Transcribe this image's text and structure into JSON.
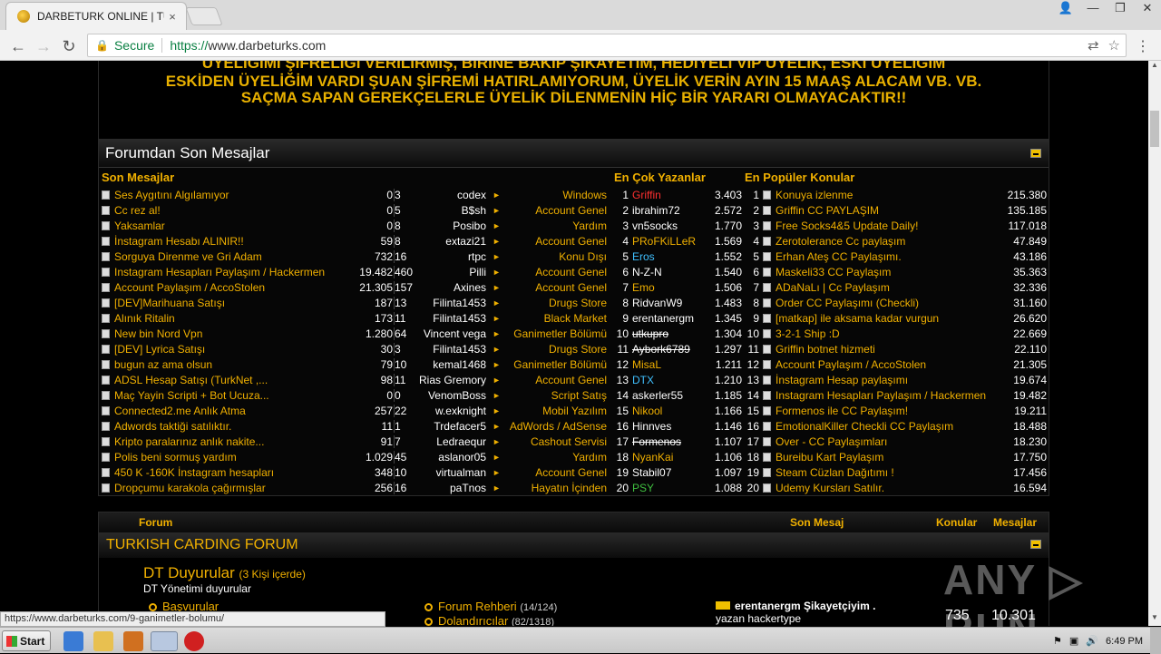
{
  "browser": {
    "tab_title": "DARBETURK ONLINE | TURK",
    "tab_close": "×",
    "secure_label": "Secure",
    "url_scheme": "https://",
    "url_host": "www.darbeturks.com",
    "back": "←",
    "forward": "→",
    "reload": "↻",
    "min": "—",
    "max": "❐",
    "close": "✕",
    "user": "👤",
    "translate": "⇄",
    "star": "☆",
    "menu": "⋮"
  },
  "notice": {
    "line1": "ÜYELİĞİMİ ŞİFRELİĞİ VERİLİRMİŞ, BİRİNE BAKIP ŞİKAYETİM, HEDİYELİ VIP ÜYELİK, ESKİ ÜYELİĞİM",
    "line2": "ESKİDEN ÜYELİĞİM VARDI ŞUAN ŞİFREMİ HATIRLAMIYORUM, ÜYELİK VERİN AYIN 15 MAAŞ ALACAM VB. VB.",
    "line3": "SAÇMA SAPAN GEREKÇELERLE ÜYELİK DİLENMENİN HİÇ BİR YARARI OLMAYACAKTIR!!"
  },
  "recent": {
    "title": "Forumdan Son Mesajlar",
    "col_recent": "Son Mesajlar",
    "col_top": "En Çok Yazanlar",
    "col_popular": "En Popüler Konular",
    "rows": [
      {
        "title": "Ses Aygıtını Algılamıyor",
        "views": "0",
        "replies": "3",
        "user": "codex",
        "cat": "Windows",
        "rank": "1",
        "top": "Griffin",
        "top_color": "#ff3030",
        "top_count": "3.403",
        "prank": "1",
        "pop": "Konuya izlenme",
        "pcount": "215.380"
      },
      {
        "title": "Cc rez al!",
        "views": "0",
        "replies": "5",
        "user": "B$sh",
        "cat": "Account Genel",
        "rank": "2",
        "top": "ibrahim72",
        "top_color": "#ffffff",
        "top_count": "2.572",
        "prank": "2",
        "pop": "Griffin CC PAYLAŞIM",
        "pcount": "135.185"
      },
      {
        "title": "Yaksamlar",
        "views": "0",
        "replies": "8",
        "user": "Posibo",
        "cat": "Yardım",
        "rank": "3",
        "top": "vn5socks",
        "top_color": "#ffffff",
        "top_count": "1.770",
        "prank": "3",
        "pop": "Free Socks4&5 Update Daily!",
        "pcount": "117.018"
      },
      {
        "title": "İnstagram Hesabı ALINIR!!",
        "views": "59",
        "replies": "8",
        "user": "extazi21",
        "cat": "Account Genel",
        "rank": "4",
        "top": "PRoFKiLLeR",
        "top_color": "#f0b000",
        "top_count": "1.569",
        "prank": "4",
        "pop": "Zerotolerance Cc paylaşım",
        "pcount": "47.849"
      },
      {
        "title": "Sorguya Direnme ve Gri Adam",
        "views": "732",
        "replies": "16",
        "user": "rtpc",
        "cat": "Konu Dışı",
        "rank": "5",
        "top": "Eros",
        "top_color": "#40c0ff",
        "top_count": "1.552",
        "prank": "5",
        "pop": "Erhan Ateş CC Paylaşımı.",
        "pcount": "43.186"
      },
      {
        "title": "Instagram Hesapları Paylaşım / Hackermen",
        "views": "19.482",
        "replies": "460",
        "user": "Pilli",
        "cat": "Account Genel",
        "rank": "6",
        "top": "N-Z-N",
        "top_color": "#ffffff",
        "top_count": "1.540",
        "prank": "6",
        "pop": "Maskeli33 CC Paylaşım",
        "pcount": "35.363"
      },
      {
        "title": "Account Paylaşım / AccoStolen",
        "views": "21.305",
        "replies": "157",
        "user": "Axines",
        "cat": "Account Genel",
        "rank": "7",
        "top": "Emo",
        "top_color": "#f0b000",
        "top_count": "1.506",
        "prank": "7",
        "pop": "ADaNaLı | Cc Paylaşım",
        "pcount": "32.336"
      },
      {
        "title": "[DEV]Marihuana Satışı",
        "views": "187",
        "replies": "13",
        "user": "Filinta1453",
        "cat": "Drugs Store",
        "rank": "8",
        "top": "RidvanW9",
        "top_color": "#ffffff",
        "top_count": "1.483",
        "prank": "8",
        "pop": "Order CC Paylaşımı (Checkli)",
        "pcount": "31.160"
      },
      {
        "title": "Alınık Ritalin",
        "views": "173",
        "replies": "11",
        "user": "Filinta1453",
        "cat": "Black Market",
        "rank": "9",
        "top": "erentanergm",
        "top_color": "#ffffff",
        "top_count": "1.345",
        "prank": "9",
        "pop": "[matkap] ile aksama kadar vurgun",
        "pcount": "26.620"
      },
      {
        "title": "New bin Nord Vpn",
        "views": "1.280",
        "replies": "64",
        "user": "Vincent vega",
        "cat": "Ganimetler Bölümü",
        "rank": "10",
        "top": "utkupro",
        "top_color": "#ffffff",
        "top_count": "1.304",
        "prank": "10",
        "pop": "3-2-1 Ship :D",
        "pcount": "22.669"
      },
      {
        "title": "[DEV] Lyrica Satışı",
        "views": "30",
        "replies": "3",
        "user": "Filinta1453",
        "cat": "Drugs Store",
        "rank": "11",
        "top": "Aybork6789",
        "top_color": "#ffffff",
        "top_count": "1.297",
        "prank": "11",
        "pop": "Griffin botnet hizmeti",
        "pcount": "22.110"
      },
      {
        "title": "bugun az ama olsun",
        "views": "79",
        "replies": "10",
        "user": "kemal1468",
        "cat": "Ganimetler Bölümü",
        "rank": "12",
        "top": "MisaL",
        "top_color": "#f0b000",
        "top_count": "1.211",
        "prank": "12",
        "pop": "Account Paylaşım / AccoStolen",
        "pcount": "21.305"
      },
      {
        "title": "ADSL Hesap Satışı (TurkNet ,...",
        "views": "98",
        "replies": "11",
        "user": "Rias Gremory",
        "cat": "Account Genel",
        "rank": "13",
        "top": "DTX",
        "top_color": "#40c0ff",
        "top_count": "1.210",
        "prank": "13",
        "pop": "İnstagram Hesap paylaşımı",
        "pcount": "19.674"
      },
      {
        "title": "Maç Yayin Scripti + Bot Ucuza...",
        "views": "0",
        "replies": "0",
        "user": "VenomBoss",
        "cat": "Script Satış",
        "rank": "14",
        "top": "askerler55",
        "top_color": "#ffffff",
        "top_count": "1.185",
        "prank": "14",
        "pop": "Instagram Hesapları Paylaşım / Hackermen",
        "pcount": "19.482"
      },
      {
        "title": "Connected2.me Anlık Atma",
        "views": "257",
        "replies": "22",
        "user": "w.exknight",
        "cat": "Mobil Yazılım",
        "rank": "15",
        "top": "Nikool",
        "top_color": "#f0b000",
        "top_count": "1.166",
        "prank": "15",
        "pop": "Formenos ile CC Paylaşım!",
        "pcount": "19.211"
      },
      {
        "title": "Adwords taktiği satılıktır.",
        "views": "11",
        "replies": "1",
        "user": "Trdefacer5",
        "cat": "AdWords / AdSense",
        "rank": "16",
        "top": "Hinnves",
        "top_color": "#ffffff",
        "top_count": "1.146",
        "prank": "16",
        "pop": "EmotionalKiller Checkli CC Paylaşım",
        "pcount": "18.488"
      },
      {
        "title": "Kripto paralarınız anlık nakite...",
        "views": "91",
        "replies": "7",
        "user": "Ledraequr",
        "cat": "Cashout Servisi",
        "rank": "17",
        "top": "Formenos",
        "top_color": "#ffffff",
        "top_count": "1.107",
        "prank": "17",
        "pop": "Over - CC Paylaşımları",
        "pcount": "18.230"
      },
      {
        "title": "Polis beni sormuş yardım",
        "views": "1.029",
        "replies": "45",
        "user": "aslanor05",
        "cat": "Yardım",
        "rank": "18",
        "top": "NyanKai",
        "top_color": "#f0b000",
        "top_count": "1.106",
        "prank": "18",
        "pop": "Bureibu Kart Paylaşım",
        "pcount": "17.750"
      },
      {
        "title": "450 K -160K İnstagram hesapları",
        "views": "348",
        "replies": "10",
        "user": "virtualman",
        "cat": "Account Genel",
        "rank": "19",
        "top": "Stabil07",
        "top_color": "#ffffff",
        "top_count": "1.097",
        "prank": "19",
        "pop": "Steam Cüzlan Dağıtımı !",
        "pcount": "17.456"
      },
      {
        "title": "Dropçumu karakola çağırmışlar",
        "views": "256",
        "replies": "16",
        "user": "paTnos",
        "cat": "Hayatın İçinden",
        "rank": "20",
        "top": "PSY",
        "top_color": "#40c040",
        "top_count": "1.088",
        "prank": "20",
        "pop": "Udemy Kursları Satılır.",
        "pcount": "16.594"
      }
    ]
  },
  "forum": {
    "col_forum": "Forum",
    "col_last": "Son Mesaj",
    "col_topics": "Konular",
    "col_posts": "Mesajlar",
    "category": "TURKISH CARDING FORUM",
    "dt_title": "DT Duyurular",
    "dt_count": "(3 Kişi içerde)",
    "dt_sub": "DT Yönetimi duyurular",
    "sub1": "Başvurular",
    "sub2": "Forum Rehberi",
    "sub2_count": "(14/124)",
    "sub3": "Dolandırıcılar",
    "sub3_count": "(82/1318)",
    "last_post": "erentanergm Şikayetçiyim .",
    "last_by": "yazan hackertype",
    "topics": "735",
    "posts": "10.301"
  },
  "status_url": "https://www.darbeturks.com/9-ganimetler-bolumu/",
  "watermark": "ANY ▷ RUN",
  "taskbar": {
    "start": "Start",
    "time": "6:49 PM"
  }
}
